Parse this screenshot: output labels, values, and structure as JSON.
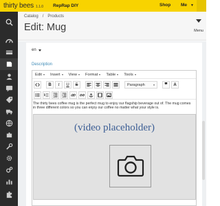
{
  "topbar": {
    "logo": "thirty bees",
    "version": "1.1.0",
    "shop_name": "RepRap DIY",
    "shop_link": "Shop",
    "user_menu": "Me"
  },
  "sidebar": {
    "items": [
      {
        "icon": "search-icon"
      },
      {
        "icon": "dashboard-icon"
      },
      {
        "icon": "orders-icon"
      },
      {
        "icon": "catalog-icon"
      },
      {
        "icon": "customers-icon"
      },
      {
        "icon": "customer-service-icon"
      },
      {
        "icon": "price-rules-icon"
      },
      {
        "icon": "shipping-icon"
      },
      {
        "icon": "localization-icon"
      },
      {
        "icon": "modules-icon"
      },
      {
        "icon": "preferences-icon"
      },
      {
        "icon": "advanced-parameters-icon"
      },
      {
        "icon": "administration-icon"
      },
      {
        "icon": "stats-icon"
      },
      {
        "icon": "extra-icon"
      }
    ]
  },
  "header": {
    "breadcrumb": [
      "Catalog",
      "Products"
    ],
    "title": "Edit: Mug",
    "menu_label": "Menu"
  },
  "form": {
    "language": "en",
    "description_label": "Description"
  },
  "editor": {
    "menus": [
      "Edit",
      "Insert",
      "View",
      "Format",
      "Table",
      "Tools"
    ],
    "paragraph_select": "Paragraph",
    "content_text": "The thirty bees coffee mug is the perfect mug to enjoy our flagship beverage out of. The mug comes in three different colors so you can enjoy our coffee no matter what your style is.",
    "video_placeholder": "(video placeholder)"
  },
  "colors": {
    "brand_yellow": "#f8d300",
    "sidebar_bg": "#2b2b2b",
    "label_blue": "#3a88b5",
    "placeholder_text": "#3d5f95"
  }
}
